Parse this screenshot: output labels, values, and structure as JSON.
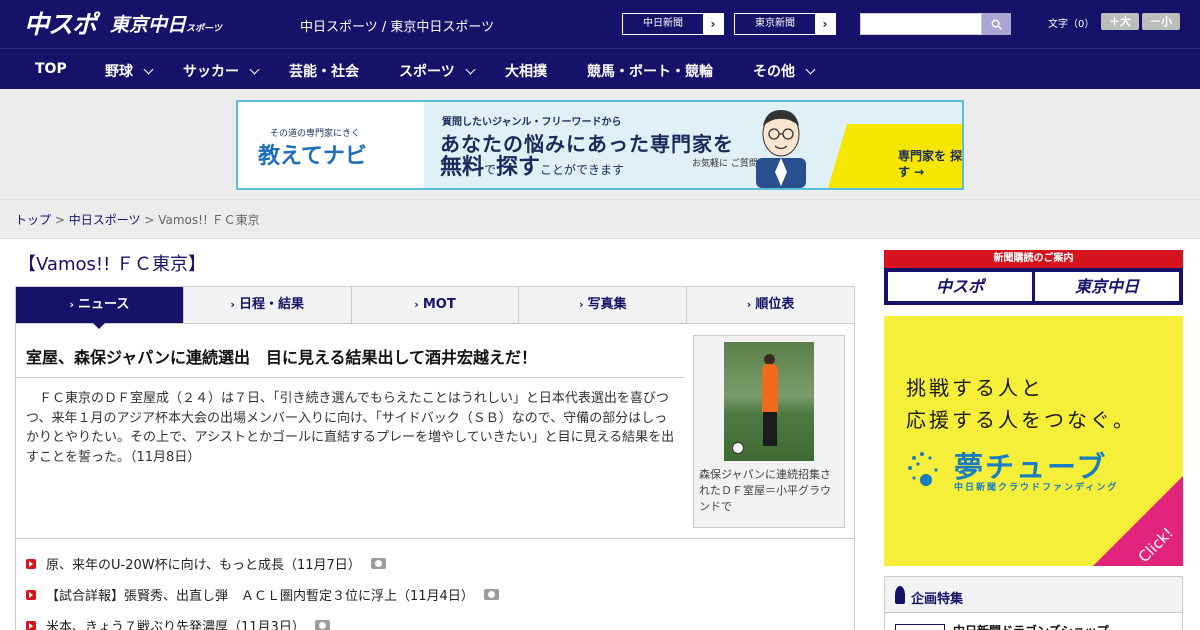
{
  "header": {
    "logo_main": "中スポ",
    "logo_sub": "東京中日",
    "logo_sub_small": "スポーツ",
    "site_title": "中日スポーツ / 東京中日スポーツ",
    "paper_links": [
      {
        "label": "中日新聞"
      },
      {
        "label": "東京新聞"
      }
    ],
    "search_placeholder": "",
    "font_size_label": "文字（0）",
    "font_bigger": "＋大",
    "font_smaller": "－小"
  },
  "nav": [
    {
      "label": "TOP",
      "dropdown": false
    },
    {
      "label": "野球",
      "dropdown": true
    },
    {
      "label": "サッカー",
      "dropdown": true
    },
    {
      "label": "芸能・社会",
      "dropdown": false
    },
    {
      "label": "スポーツ",
      "dropdown": true
    },
    {
      "label": "大相撲",
      "dropdown": false
    },
    {
      "label": "競馬・ボート・競輪",
      "dropdown": false
    },
    {
      "label": "その他",
      "dropdown": true
    }
  ],
  "banner": {
    "tagline": "その道の専門家にきく",
    "brand": "教えてナビ",
    "line1": "質問したいジャンル・フリーワードから",
    "line2": "あなたの悩みにあった専門家を",
    "line3a": "無料",
    "line3b": "で",
    "line3c": "探す",
    "line3d": "ことができます",
    "note": "お気軽に ご質問ください!",
    "cta": "専門家を 探す →"
  },
  "breadcrumb": {
    "home": "トップ",
    "section": "中日スポーツ",
    "current": "Vamos!! ＦＣ東京",
    "sep": ">"
  },
  "main": {
    "page_title": "【Vamos!! ＦＣ東京】",
    "tabs": [
      {
        "label": "ニュース",
        "active": true
      },
      {
        "label": "日程・結果",
        "active": false
      },
      {
        "label": "MOT",
        "active": false
      },
      {
        "label": "写真集",
        "active": false
      },
      {
        "label": "順位表",
        "active": false
      }
    ],
    "headline": "室屋、森保ジャパンに連続選出　目に見える結果出して酒井宏越えだ！",
    "body": "　ＦＣ東京のＤＦ室屋成（２４）は７日、「引き続き選んでもらえたことはうれしい」と日本代表選出を喜びつつ、来年１月のアジア杯本大会の出場メンバー入りに向け、「サイドバック（ＳＢ）なので、守備の部分はしっかりとやりたい。その上で、アシストとかゴールに直結するプレーを増やしていきたい」と目に見える結果を出すことを誓った。（11月8日）",
    "photo_caption": "森保ジャパンに連続招集されたＤＦ室屋＝小平グラウンドで",
    "related": [
      {
        "label": "原、来年のU-20W杯に向け、もっと成長（11月7日）",
        "photo": true
      },
      {
        "label": "【試合詳報】張賢秀、出直し弾　ＡＣＬ圏内暫定３位に浮上（11月4日）",
        "photo": true
      },
      {
        "label": "米本、きょう７戦ぶり先発濃厚（11月3日）",
        "photo": true
      }
    ]
  },
  "sidebar": {
    "subscribe_head": "新聞購読のご案内",
    "subscribe_buttons": [
      "中スポ",
      "東京中日"
    ],
    "ad_line1": "挑戦する人と",
    "ad_line2": "応援する人をつなぐ。",
    "ad_brand": "夢チューブ",
    "ad_brand_sub": "中日新聞クラウドファンディング",
    "ad_click": "Click!",
    "feature_title": "企画特集",
    "feature_item": "中日新聞ドラゴンズショップ"
  },
  "colors": {
    "brand_navy": "#16126a",
    "accent_red": "#d6141f",
    "banner_border": "#58c0de",
    "ad_yellow": "#f5ef3a"
  }
}
